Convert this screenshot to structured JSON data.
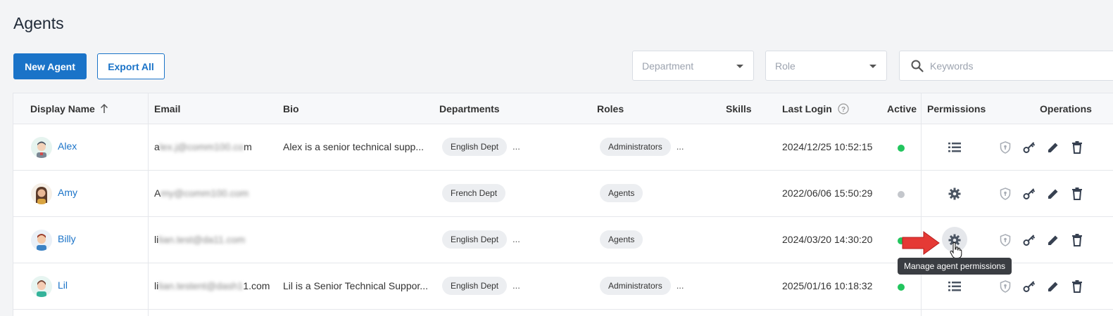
{
  "page": {
    "title": "Agents"
  },
  "toolbar": {
    "new_agent": "New Agent",
    "export_all": "Export All"
  },
  "filters": {
    "department_placeholder": "Department",
    "role_placeholder": "Role",
    "search_placeholder": "Keywords"
  },
  "table": {
    "columns": {
      "display_name": "Display Name",
      "email": "Email",
      "bio": "Bio",
      "departments": "Departments",
      "roles": "Roles",
      "skills": "Skills",
      "last_login": "Last Login",
      "active": "Active",
      "permissions": "Permissions",
      "operations": "Operations"
    },
    "rows": [
      {
        "name": "Alex",
        "email_prefix": "a",
        "email_blur": "lex.j@comm100.co",
        "email_suffix": "m",
        "bio": "Alex is a senior technical supp...",
        "department": "English Dept",
        "dept_more": "...",
        "role": "Administrators",
        "role_more": "...",
        "last_login": "2024/12/25 10:52:15",
        "active": true,
        "permission_icon": "list-icon"
      },
      {
        "name": "Amy",
        "email_prefix": "A",
        "email_blur": "my@comm100.com",
        "email_suffix": "",
        "bio": "",
        "department": "French Dept",
        "dept_more": "",
        "role": "Agents",
        "role_more": "",
        "last_login": "2022/06/06 15:50:29",
        "active": false,
        "permission_icon": "gear-icon"
      },
      {
        "name": "Billy",
        "email_prefix": "li",
        "email_blur": "lian.test@da11.com",
        "email_suffix": "",
        "bio": "",
        "department": "English Dept",
        "dept_more": "...",
        "role": "Agents",
        "role_more": "",
        "last_login": "2024/03/20 14:30:20",
        "active": true,
        "permission_icon": "gear-icon"
      },
      {
        "name": "Lil",
        "email_prefix": "li",
        "email_blur": "lian.testent@dash1",
        "email_suffix": "1.com",
        "bio": "Lil is a Senior Technical Suppor...",
        "department": "English Dept",
        "dept_more": "...",
        "role": "Administrators",
        "role_more": "...",
        "last_login": "2025/01/16 10:18:32",
        "active": true,
        "permission_icon": "list-icon"
      }
    ]
  },
  "tooltip": {
    "text": "Manage agent permissions"
  },
  "colors": {
    "accent": "#1a73c8",
    "active": "#22c55e",
    "inactive": "#c4c7cc",
    "annotation_arrow": "#e53935"
  }
}
